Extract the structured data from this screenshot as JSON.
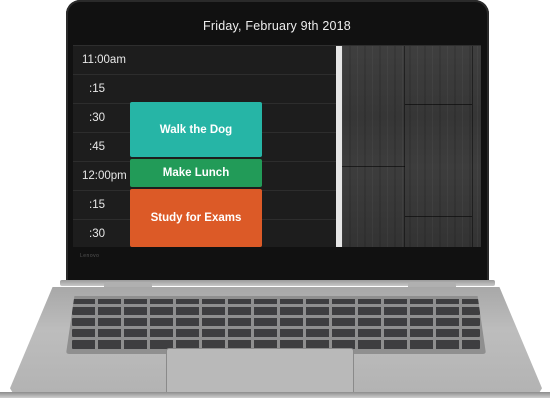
{
  "header": {
    "date": "Friday, February 9th 2018"
  },
  "device": {
    "brand": "Lenovo"
  },
  "schedule": {
    "times": [
      "11:00am",
      ":15",
      ":30",
      ":45",
      "12:00pm",
      ":15",
      ":30"
    ]
  },
  "events": [
    {
      "title": "Walk the Dog",
      "color": "#26b5a6"
    },
    {
      "title": "Make Lunch",
      "color": "#229b58"
    },
    {
      "title": "Study for Exams",
      "color": "#dc5a27"
    }
  ]
}
